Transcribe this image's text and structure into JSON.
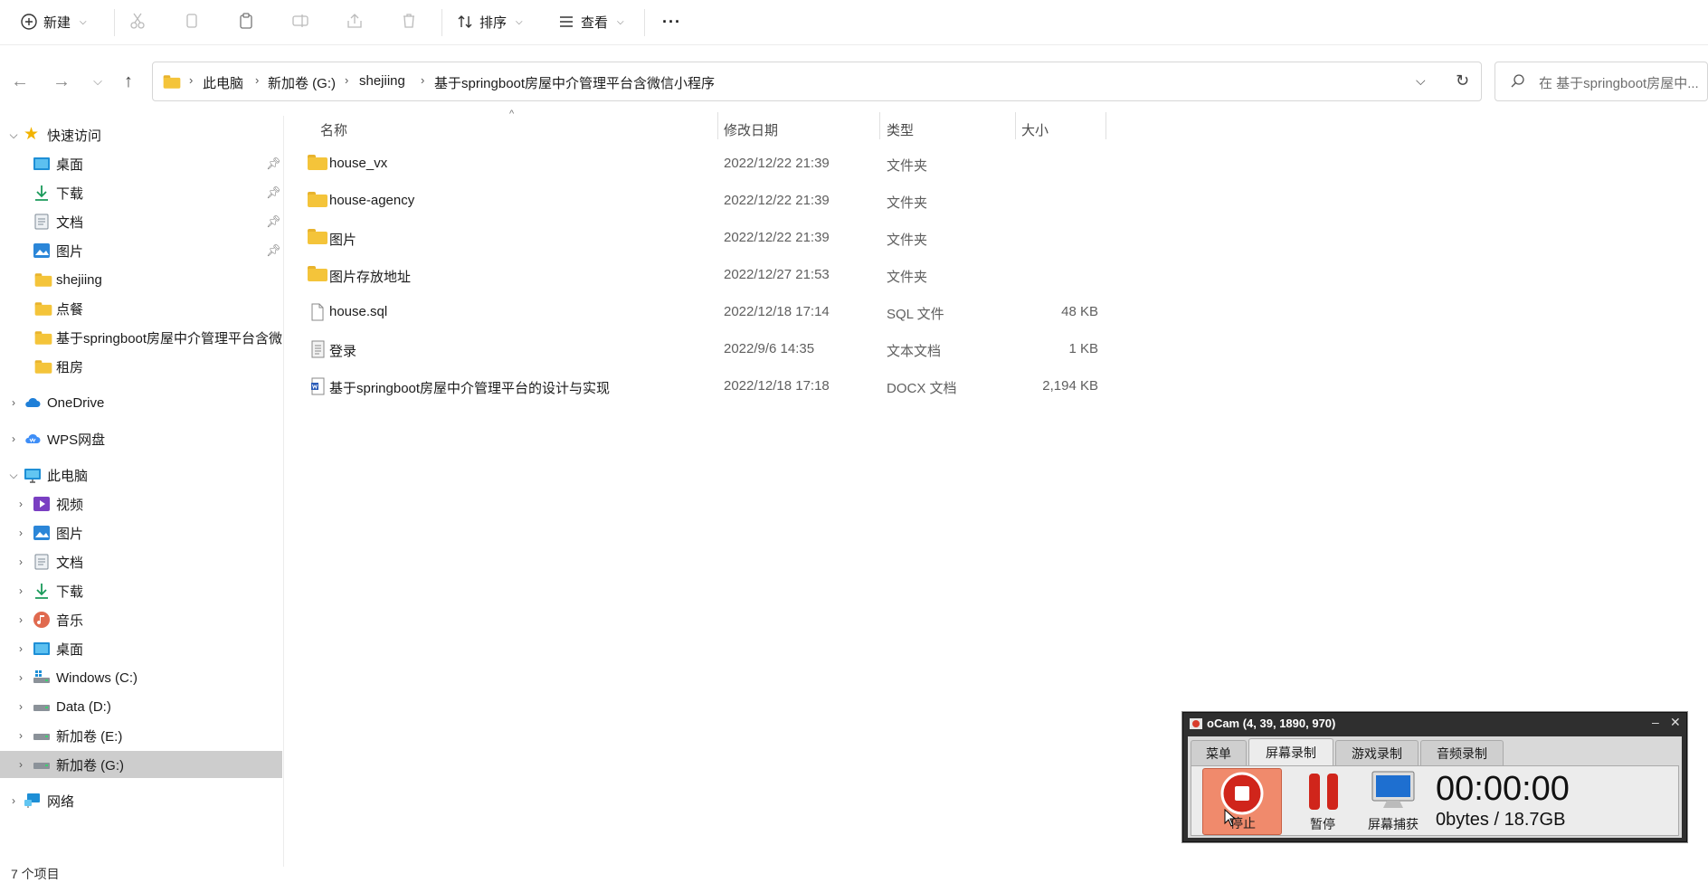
{
  "toolbar": {
    "new_label": "新建",
    "sort_label": "排序",
    "view_label": "查看",
    "more_label": "···"
  },
  "address": {
    "breadcrumbs": [
      "此电脑",
      "新加卷 (G:)",
      "shejiing",
      "基于springboot房屋中介管理平台含微信小程序"
    ],
    "search_placeholder": "在 基于springboot房屋中..."
  },
  "sidebar": {
    "quick_access": "快速访问",
    "quick_items": [
      {
        "label": "桌面",
        "icon": "desktop-icon",
        "pinned": true
      },
      {
        "label": "下载",
        "icon": "download-icon",
        "pinned": true
      },
      {
        "label": "文档",
        "icon": "document-icon",
        "pinned": true
      },
      {
        "label": "图片",
        "icon": "picture-icon",
        "pinned": true
      },
      {
        "label": "shejiing",
        "icon": "folder-icon",
        "pinned": false
      },
      {
        "label": "点餐",
        "icon": "folder-icon",
        "pinned": false
      },
      {
        "label": "基于springboot房屋中介管理平台含微",
        "icon": "folder-icon",
        "pinned": false
      },
      {
        "label": "租房",
        "icon": "folder-icon",
        "pinned": false
      }
    ],
    "onedrive": "OneDrive",
    "wps": "WPS网盘",
    "this_pc": "此电脑",
    "pc_items": [
      {
        "label": "视频",
        "icon": "video-icon"
      },
      {
        "label": "图片",
        "icon": "picture-icon"
      },
      {
        "label": "文档",
        "icon": "document-icon"
      },
      {
        "label": "下载",
        "icon": "download-icon"
      },
      {
        "label": "音乐",
        "icon": "music-icon"
      },
      {
        "label": "桌面",
        "icon": "desktop-icon"
      },
      {
        "label": "Windows (C:)",
        "icon": "drive-icon"
      },
      {
        "label": "Data (D:)",
        "icon": "drive-icon"
      },
      {
        "label": "新加卷 (E:)",
        "icon": "drive-icon"
      },
      {
        "label": "新加卷 (G:)",
        "icon": "drive-icon",
        "selected": true
      }
    ],
    "network": "网络"
  },
  "columns": {
    "name": "名称",
    "date": "修改日期",
    "type": "类型",
    "size": "大小"
  },
  "files": [
    {
      "name": "house_vx",
      "date": "2022/12/22 21:39",
      "type": "文件夹",
      "size": "",
      "icon": "folder-icon"
    },
    {
      "name": "house-agency",
      "date": "2022/12/22 21:39",
      "type": "文件夹",
      "size": "",
      "icon": "folder-icon"
    },
    {
      "name": "图片",
      "date": "2022/12/22 21:39",
      "type": "文件夹",
      "size": "",
      "icon": "folder-icon"
    },
    {
      "name": "图片存放地址",
      "date": "2022/12/27 21:53",
      "type": "文件夹",
      "size": "",
      "icon": "folder-icon"
    },
    {
      "name": "house.sql",
      "date": "2022/12/18 17:14",
      "type": "SQL 文件",
      "size": "48 KB",
      "icon": "file-icon"
    },
    {
      "name": "登录",
      "date": "2022/9/6 14:35",
      "type": "文本文档",
      "size": "1 KB",
      "icon": "text-file-icon"
    },
    {
      "name": "基于springboot房屋中介管理平台的设计与实现",
      "date": "2022/12/18 17:18",
      "type": "DOCX 文档",
      "size": "2,194 KB",
      "icon": "docx-icon"
    }
  ],
  "status": {
    "item_count": "7 个项目"
  },
  "ocam": {
    "title": "oCam (4, 39, 1890, 970)",
    "tabs": [
      "菜单",
      "屏幕录制",
      "游戏录制",
      "音频录制"
    ],
    "active_tab": "屏幕录制",
    "stop_label": "停止",
    "pause_label": "暂停",
    "capture_label": "屏幕捕获",
    "timer": "00:00:00",
    "bytes": "0bytes / 18.7GB"
  }
}
